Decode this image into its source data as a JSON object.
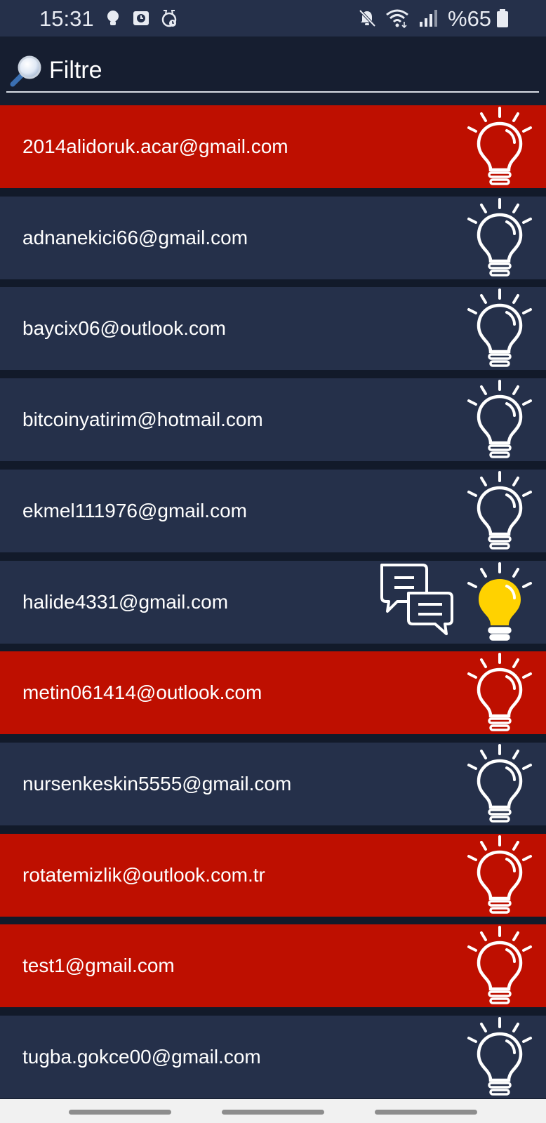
{
  "status_bar": {
    "time": "15:31",
    "battery_text": "%65",
    "icons": [
      "bulb-notification-icon",
      "photo-notification-icon",
      "alarm-notification-icon",
      "mute-icon",
      "wifi-icon",
      "signal-icon",
      "battery-icon"
    ]
  },
  "search": {
    "placeholder": "Filtre",
    "icon": "magnifier-icon"
  },
  "colors": {
    "alert_row": "#be0f00",
    "normal_row": "#25304a",
    "bulb_active": "#ffd200"
  },
  "contacts": [
    {
      "email": "2014alidoruk.acar@gmail.com",
      "row_state": "alert",
      "bulb": "outline",
      "has_chat": false
    },
    {
      "email": "adnanekici66@gmail.com",
      "row_state": "normal",
      "bulb": "outline",
      "has_chat": false
    },
    {
      "email": "baycix06@outlook.com",
      "row_state": "normal",
      "bulb": "outline",
      "has_chat": false
    },
    {
      "email": "bitcoinyatirim@hotmail.com",
      "row_state": "normal",
      "bulb": "outline",
      "has_chat": false
    },
    {
      "email": "ekmel111976@gmail.com",
      "row_state": "normal",
      "bulb": "outline",
      "has_chat": false
    },
    {
      "email": "halide4331@gmail.com",
      "row_state": "normal",
      "bulb": "lit",
      "has_chat": true
    },
    {
      "email": "metin061414@outlook.com",
      "row_state": "alert",
      "bulb": "outline",
      "has_chat": false
    },
    {
      "email": "nursenkeskin5555@gmail.com",
      "row_state": "normal",
      "bulb": "outline",
      "has_chat": false
    },
    {
      "email": "rotatemizlik@outlook.com.tr",
      "row_state": "alert",
      "bulb": "outline",
      "has_chat": false
    },
    {
      "email": "test1@gmail.com",
      "row_state": "alert",
      "bulb": "outline",
      "has_chat": false
    },
    {
      "email": "tugba.gokce00@gmail.com",
      "row_state": "normal",
      "bulb": "outline",
      "has_chat": false
    }
  ]
}
